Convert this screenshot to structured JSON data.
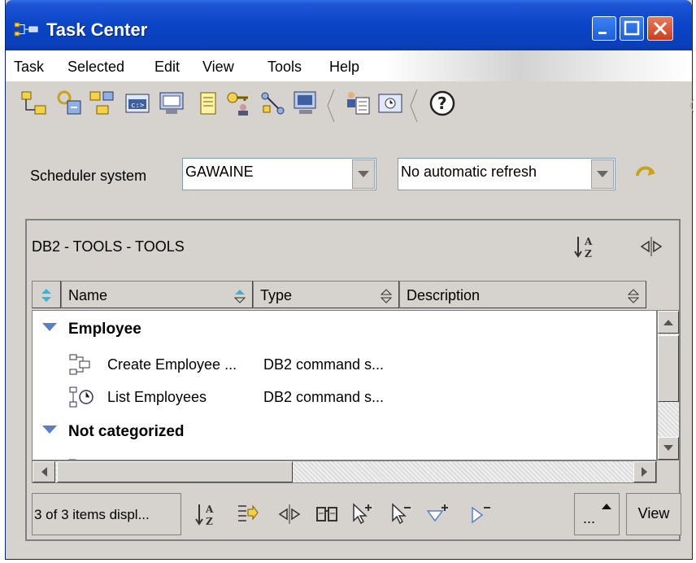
{
  "window": {
    "title": "Task Center"
  },
  "menu": [
    "Task",
    "Selected",
    "Edit",
    "View",
    "Tools",
    "Help"
  ],
  "toolbar": {
    "icons": [
      "task-hierarchy-icon",
      "run-task-icon",
      "tasks-icon",
      "command-window-icon",
      "monitor-icon",
      "journal-icon",
      "key-user-icon",
      "connections-icon",
      "computer-icon",
      "notification-icon",
      "scheduler-icon",
      "help-icon"
    ],
    "help_glyph": "?"
  },
  "scheduler": {
    "label": "Scheduler system",
    "value": "GAWAINE",
    "refresh_value": "No automatic refresh"
  },
  "panel": {
    "title": "DB2 - TOOLS - TOOLS",
    "columns": [
      "Name",
      "Type",
      "Description"
    ],
    "categories": [
      {
        "name": "Employee",
        "items": [
          {
            "name": "Create Employee ...",
            "type": "DB2 command s..."
          },
          {
            "name": "List Employees",
            "type": "DB2 command s..."
          }
        ]
      },
      {
        "name": "Not categorized",
        "items": []
      }
    ],
    "status": "3 of 3 items displ...",
    "more_label": "...",
    "view_label": "View"
  },
  "colors": {
    "title_bar": "#0a45c7",
    "window_bg": "#d6d3ce",
    "icon_blue": "#5a7fc7",
    "icon_gold": "#c7a21a"
  }
}
